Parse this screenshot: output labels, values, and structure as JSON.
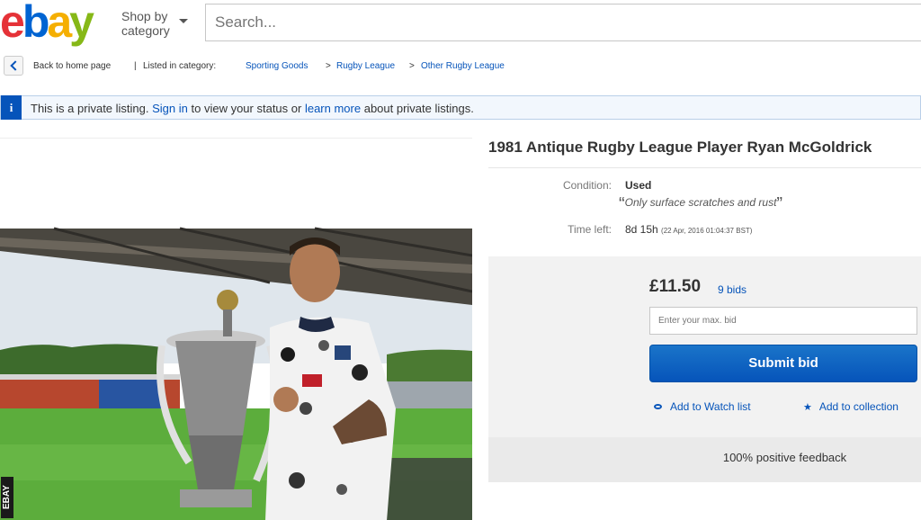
{
  "header": {
    "logo_letters": [
      "e",
      "b",
      "a",
      "y"
    ],
    "shop_by_line1": "Shop by",
    "shop_by_line2": "category",
    "search_placeholder": "Search..."
  },
  "breadcrumb": {
    "back_label": "Back to home page",
    "separator": "|",
    "listed_in": "Listed in category:",
    "path": [
      "Sporting Goods",
      "Rugby League",
      "Other Rugby League"
    ],
    "arrow": ">"
  },
  "private_banner": {
    "icon": "i",
    "text_1": "This is a private listing.",
    "sign_in": "Sign in",
    "text_2": "to view your status or",
    "learn_more": "learn more",
    "text_3": "about private listings."
  },
  "listing": {
    "title": "1981 Antique Rugby League Player Ryan McGoldrick",
    "condition_label": "Condition:",
    "condition_value": "Used",
    "condition_note": "Only surface scratches and rust",
    "time_left_label": "Time left:",
    "time_left_value": "8d 15h",
    "time_left_detail": "(22 Apr, 2016   01:04:37 BST)",
    "photo_watermark": "EBAY"
  },
  "bid": {
    "price": "£11.50",
    "bids": "9 bids",
    "max_bid_placeholder": "Enter your max. bid",
    "submit_label": "Submit bid",
    "watch_label": "Add to Watch list",
    "collection_label": "Add to collection",
    "feedback": "100% positive feedback"
  },
  "icons": {
    "back": "chevron-left-icon",
    "info": "info-icon",
    "watch": "eye-icon",
    "collection": "star-icon",
    "dropdown": "caret-down-icon"
  },
  "colors": {
    "link": "#0654ba",
    "button": "#0654ba",
    "logo_e": "#e53238",
    "logo_b": "#0064d2",
    "logo_a": "#f5af02",
    "logo_y": "#86b817"
  }
}
